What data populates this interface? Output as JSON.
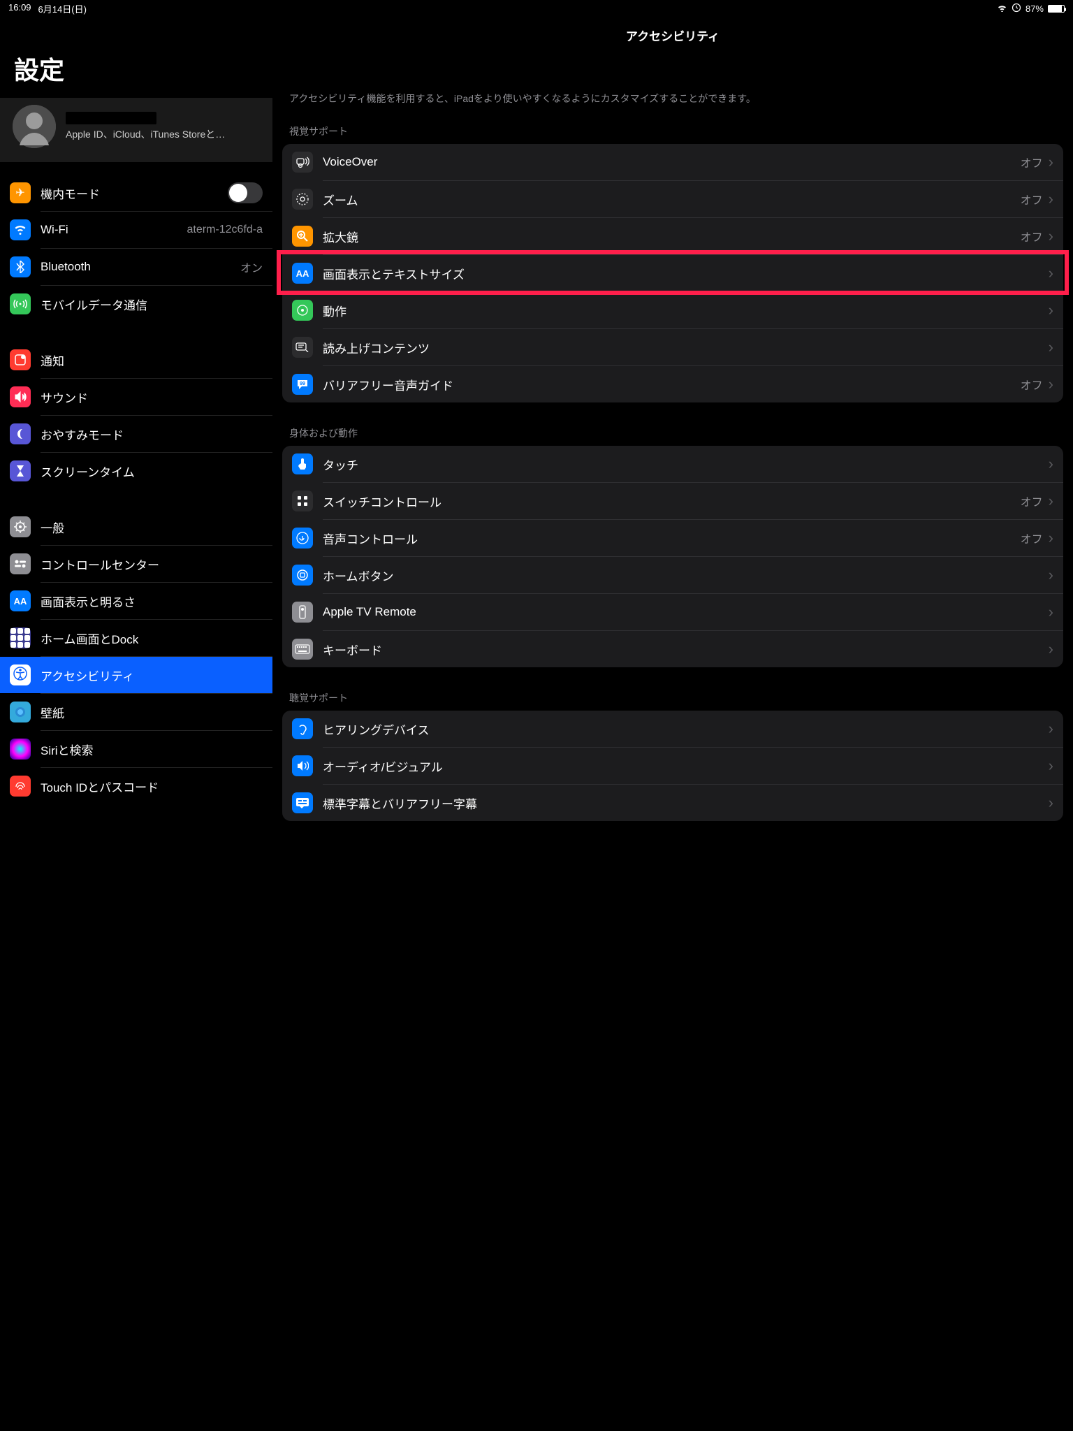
{
  "status": {
    "time": "16:09",
    "date": "6月14日(日)",
    "battery_pct": "87%"
  },
  "sidebar": {
    "title": "設定",
    "profile_sub": "Apple ID、iCloud、iTunes Storeと…",
    "items": {
      "airplane": "機内モード",
      "wifi": "Wi-Fi",
      "wifi_val": "aterm-12c6fd-a",
      "bt": "Bluetooth",
      "bt_val": "オン",
      "cell": "モバイルデータ通信",
      "notif": "通知",
      "sound": "サウンド",
      "dnd": "おやすみモード",
      "screen": "スクリーンタイム",
      "general": "一般",
      "cc": "コントロールセンター",
      "display": "画面表示と明るさ",
      "home": "ホーム画面とDock",
      "acc": "アクセシビリティ",
      "wall": "壁紙",
      "siri": "Siriと検索",
      "touch": "Touch IDとパスコード"
    }
  },
  "content": {
    "title": "アクセシビリティ",
    "desc": "アクセシビリティ機能を利用すると、iPadをより使いやすくなるようにカスタマイズすることができます。",
    "off": "オフ",
    "sections": {
      "vision": "視覚サポート",
      "physical": "身体および動作",
      "hearing": "聴覚サポート"
    },
    "rows": {
      "voiceover": "VoiceOver",
      "zoom": "ズーム",
      "magnifier": "拡大鏡",
      "display": "画面表示とテキストサイズ",
      "motion": "動作",
      "spoken": "読み上げコンテンツ",
      "audiodesc": "バリアフリー音声ガイド",
      "touch": "タッチ",
      "switch": "スイッチコントロール",
      "voicectrl": "音声コントロール",
      "homebtn": "ホームボタン",
      "appletv": "Apple TV Remote",
      "keyboard": "キーボード",
      "hearing": "ヒアリングデバイス",
      "av": "オーディオ/ビジュアル",
      "subs": "標準字幕とバリアフリー字幕"
    }
  }
}
